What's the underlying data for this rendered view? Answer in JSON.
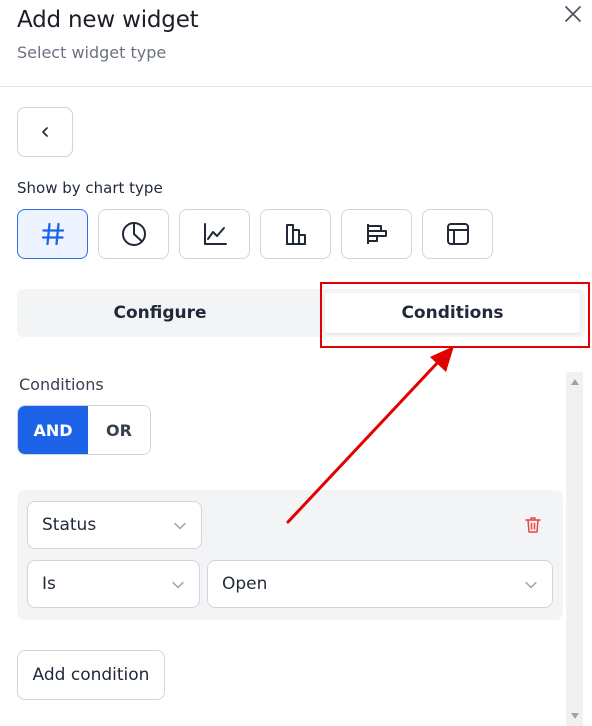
{
  "header": {
    "title": "Add new widget",
    "subtitle": "Select widget type"
  },
  "chart_types": {
    "label": "Show by chart type",
    "items": [
      {
        "icon": "hash-icon",
        "active": true
      },
      {
        "icon": "pie-chart-icon",
        "active": false
      },
      {
        "icon": "line-chart-icon",
        "active": false
      },
      {
        "icon": "bar-chart-icon",
        "active": false
      },
      {
        "icon": "horizontal-bar-chart-icon",
        "active": false
      },
      {
        "icon": "table-icon",
        "active": false
      }
    ]
  },
  "tabs": {
    "configure": "Configure",
    "conditions": "Conditions",
    "active": "conditions"
  },
  "conditions": {
    "label": "Conditions",
    "logic": {
      "and": "AND",
      "or": "OR",
      "selected": "AND"
    },
    "rows": [
      {
        "field": "Status",
        "operator": "Is",
        "value": "Open"
      }
    ],
    "add_label": "Add condition"
  },
  "colors": {
    "accent": "#1d63e8",
    "annotation": "#e30000",
    "delete": "#ef4444"
  }
}
